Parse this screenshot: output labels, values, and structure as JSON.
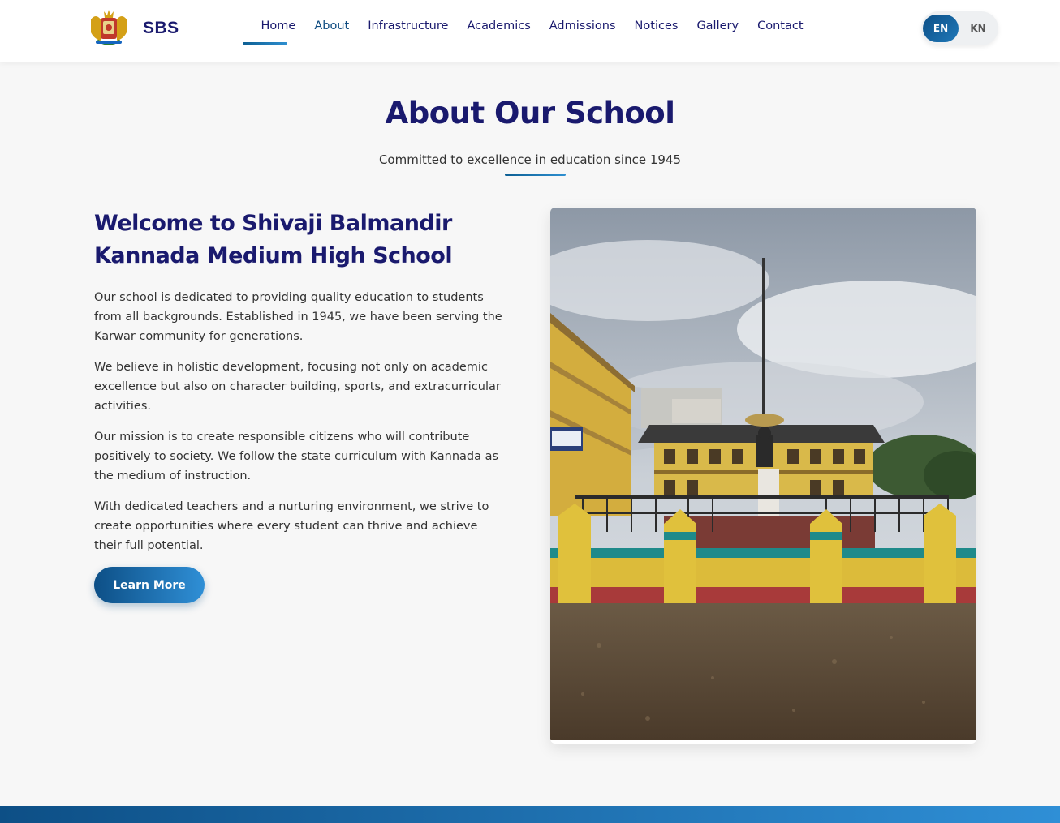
{
  "nav": {
    "brand": "SBS",
    "logo_icon": "karnataka-emblem-icon",
    "links": [
      {
        "label": "Home",
        "active": true
      },
      {
        "label": "About",
        "current": true
      },
      {
        "label": "Infrastructure"
      },
      {
        "label": "Academics"
      },
      {
        "label": "Admissions"
      },
      {
        "label": "Notices"
      },
      {
        "label": "Gallery"
      },
      {
        "label": "Contact"
      }
    ],
    "lang": {
      "en": "EN",
      "kn": "KN",
      "selected": "EN"
    }
  },
  "about": {
    "title": "About Our School",
    "subtitle": "Committed to excellence in education since 1945",
    "welcome_heading": "Welcome to Shivaji Balmandir Kannada Medium High School",
    "paragraphs": [
      "Our school is dedicated to providing quality education to students from all backgrounds. Established in 1945, we have been serving the Karwar community for generations.",
      "We believe in holistic development, focusing not only on academic excellence but also on character building, sports, and extracurricular activities.",
      "Our mission is to create responsible citizens who will contribute positively to society. We follow the state curriculum with Kannada as the medium of instruction.",
      "With dedicated teachers and a nurturing environment, we strive to create opportunities where every student can thrive and achieve their full potential."
    ],
    "button_label": "Learn More"
  },
  "colors": {
    "primary": "#1a1a6e",
    "accent": "#1f78b8",
    "accent_dark": "#0d4f86",
    "background": "#f7f7f7"
  }
}
